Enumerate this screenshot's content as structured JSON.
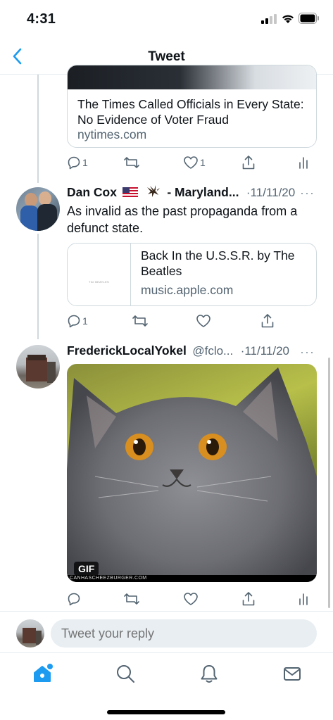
{
  "status_bar": {
    "time": "4:31"
  },
  "nav": {
    "title": "Tweet"
  },
  "tweet1": {
    "card_text": "The Times Called Officials in Every State: No Evidence of Voter Fraud",
    "card_domain": "nytimes.com",
    "reply_count": "1",
    "like_count": "1"
  },
  "tweet2": {
    "name": "Dan Cox",
    "name_suffix": "- Maryland...",
    "date": "·11/11/20",
    "more": "···",
    "text": "As invalid as the past propaganda from a defunct state.",
    "card_title": "Back In the U.S.S.R. by The Beatles",
    "card_thumb_text": "The BEATLES",
    "card_domain": "music.apple.com",
    "reply_count": "1"
  },
  "tweet3": {
    "name": "FrederickLocalYokel",
    "handle": "@fclo...",
    "date": "·11/11/20",
    "more": "···",
    "media_badge": "GIF",
    "media_watermark": "CANHASCHEEZBURGER.COM"
  },
  "reply": {
    "placeholder": "Tweet your reply"
  },
  "icons": {
    "back": "chevron-left-icon",
    "reply": "speech-bubble-icon",
    "retweet": "retweet-icon",
    "like": "heart-icon",
    "share": "share-icon",
    "analytics": "bar-chart-icon",
    "home": "home-icon",
    "search": "search-icon",
    "notifications": "bell-icon",
    "messages": "mail-icon"
  },
  "colors": {
    "accent": "#1d9bf0",
    "secondary_text": "#536471",
    "border": "#cfd9de"
  }
}
